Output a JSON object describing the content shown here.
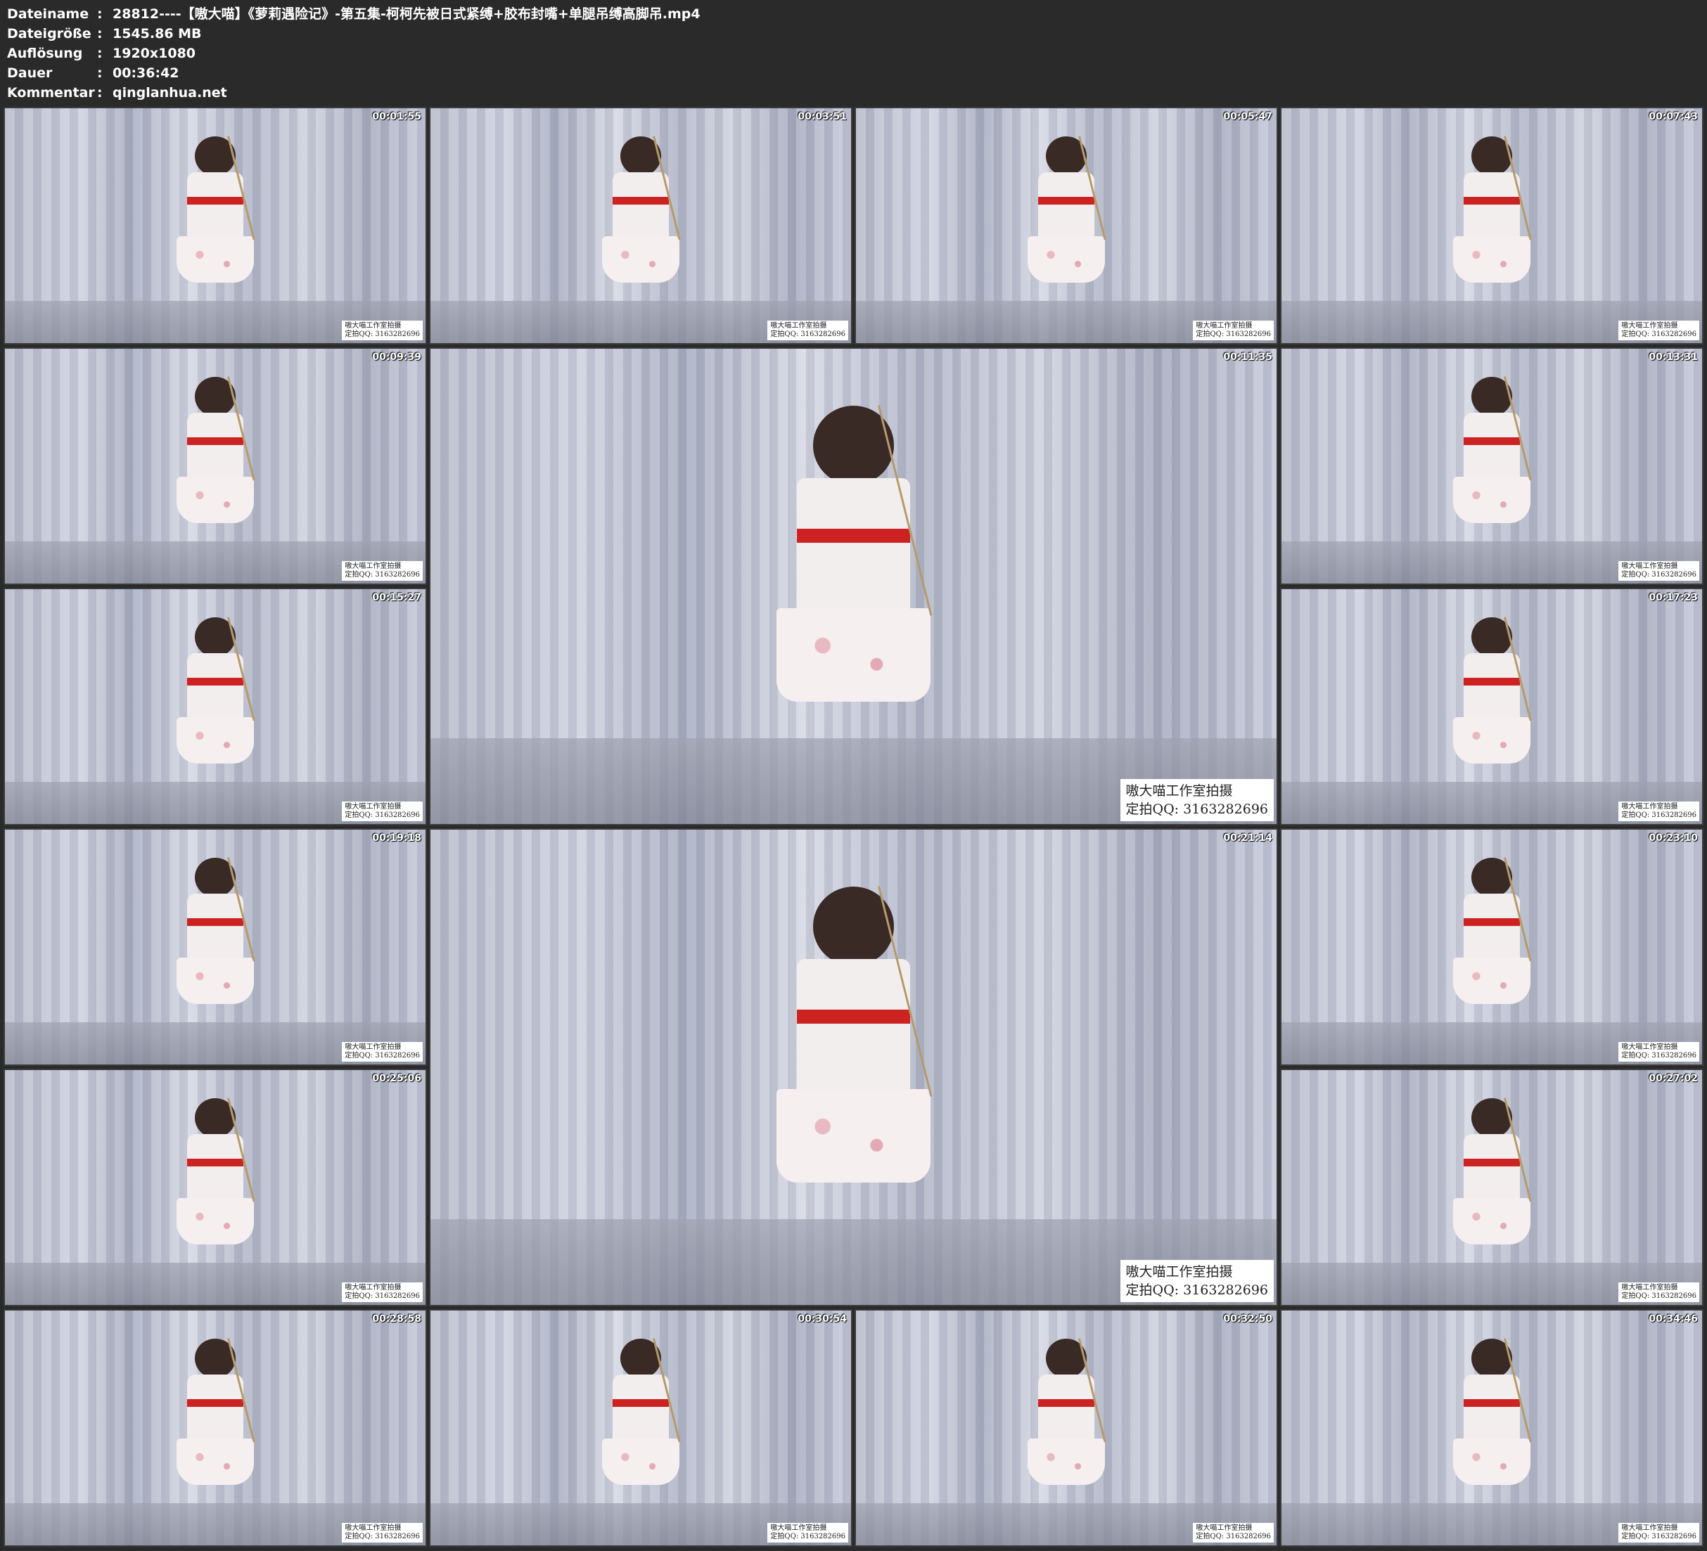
{
  "info": {
    "rows": [
      {
        "key": "Dateiname",
        "sep": ":",
        "value": "28812----【嗷大喵】《萝莉遇险记》-第五集-柯柯先被日式紧缚+胶布封嘴+单腿吊缚高脚吊.mp4"
      },
      {
        "key": "Dateigröße",
        "sep": ":",
        "value": "1545.86 MB"
      },
      {
        "key": "Auflösung",
        "sep": ":",
        "value": "1920x1080"
      },
      {
        "key": "Dauer",
        "sep": ":",
        "value": "00:36:42"
      },
      {
        "key": "Kommentar",
        "sep": ":",
        "value": "qinglanhua.net"
      }
    ]
  },
  "watermark": {
    "line1": "嗷大喵工作室拍摄",
    "line2": "定拍QQ: 3163282696"
  },
  "thumbnails": [
    {
      "time": "00:01:55"
    },
    {
      "time": "00:03:51"
    },
    {
      "time": "00:05:47"
    },
    {
      "time": "00:07:43"
    },
    {
      "time": "00:09:39"
    },
    {
      "time": "00:11:35"
    },
    {
      "time": "00:13:31"
    },
    {
      "time": "00:15:27"
    },
    {
      "time": "00:17:23"
    },
    {
      "time": "00:19:18"
    },
    {
      "time": "00:21:14"
    },
    {
      "time": "00:23:10"
    },
    {
      "time": "00:25:06"
    },
    {
      "time": "00:27:02"
    },
    {
      "time": "00:28:58"
    },
    {
      "time": "00:30:54"
    },
    {
      "time": "00:32:50"
    },
    {
      "time": "00:34:46"
    }
  ]
}
